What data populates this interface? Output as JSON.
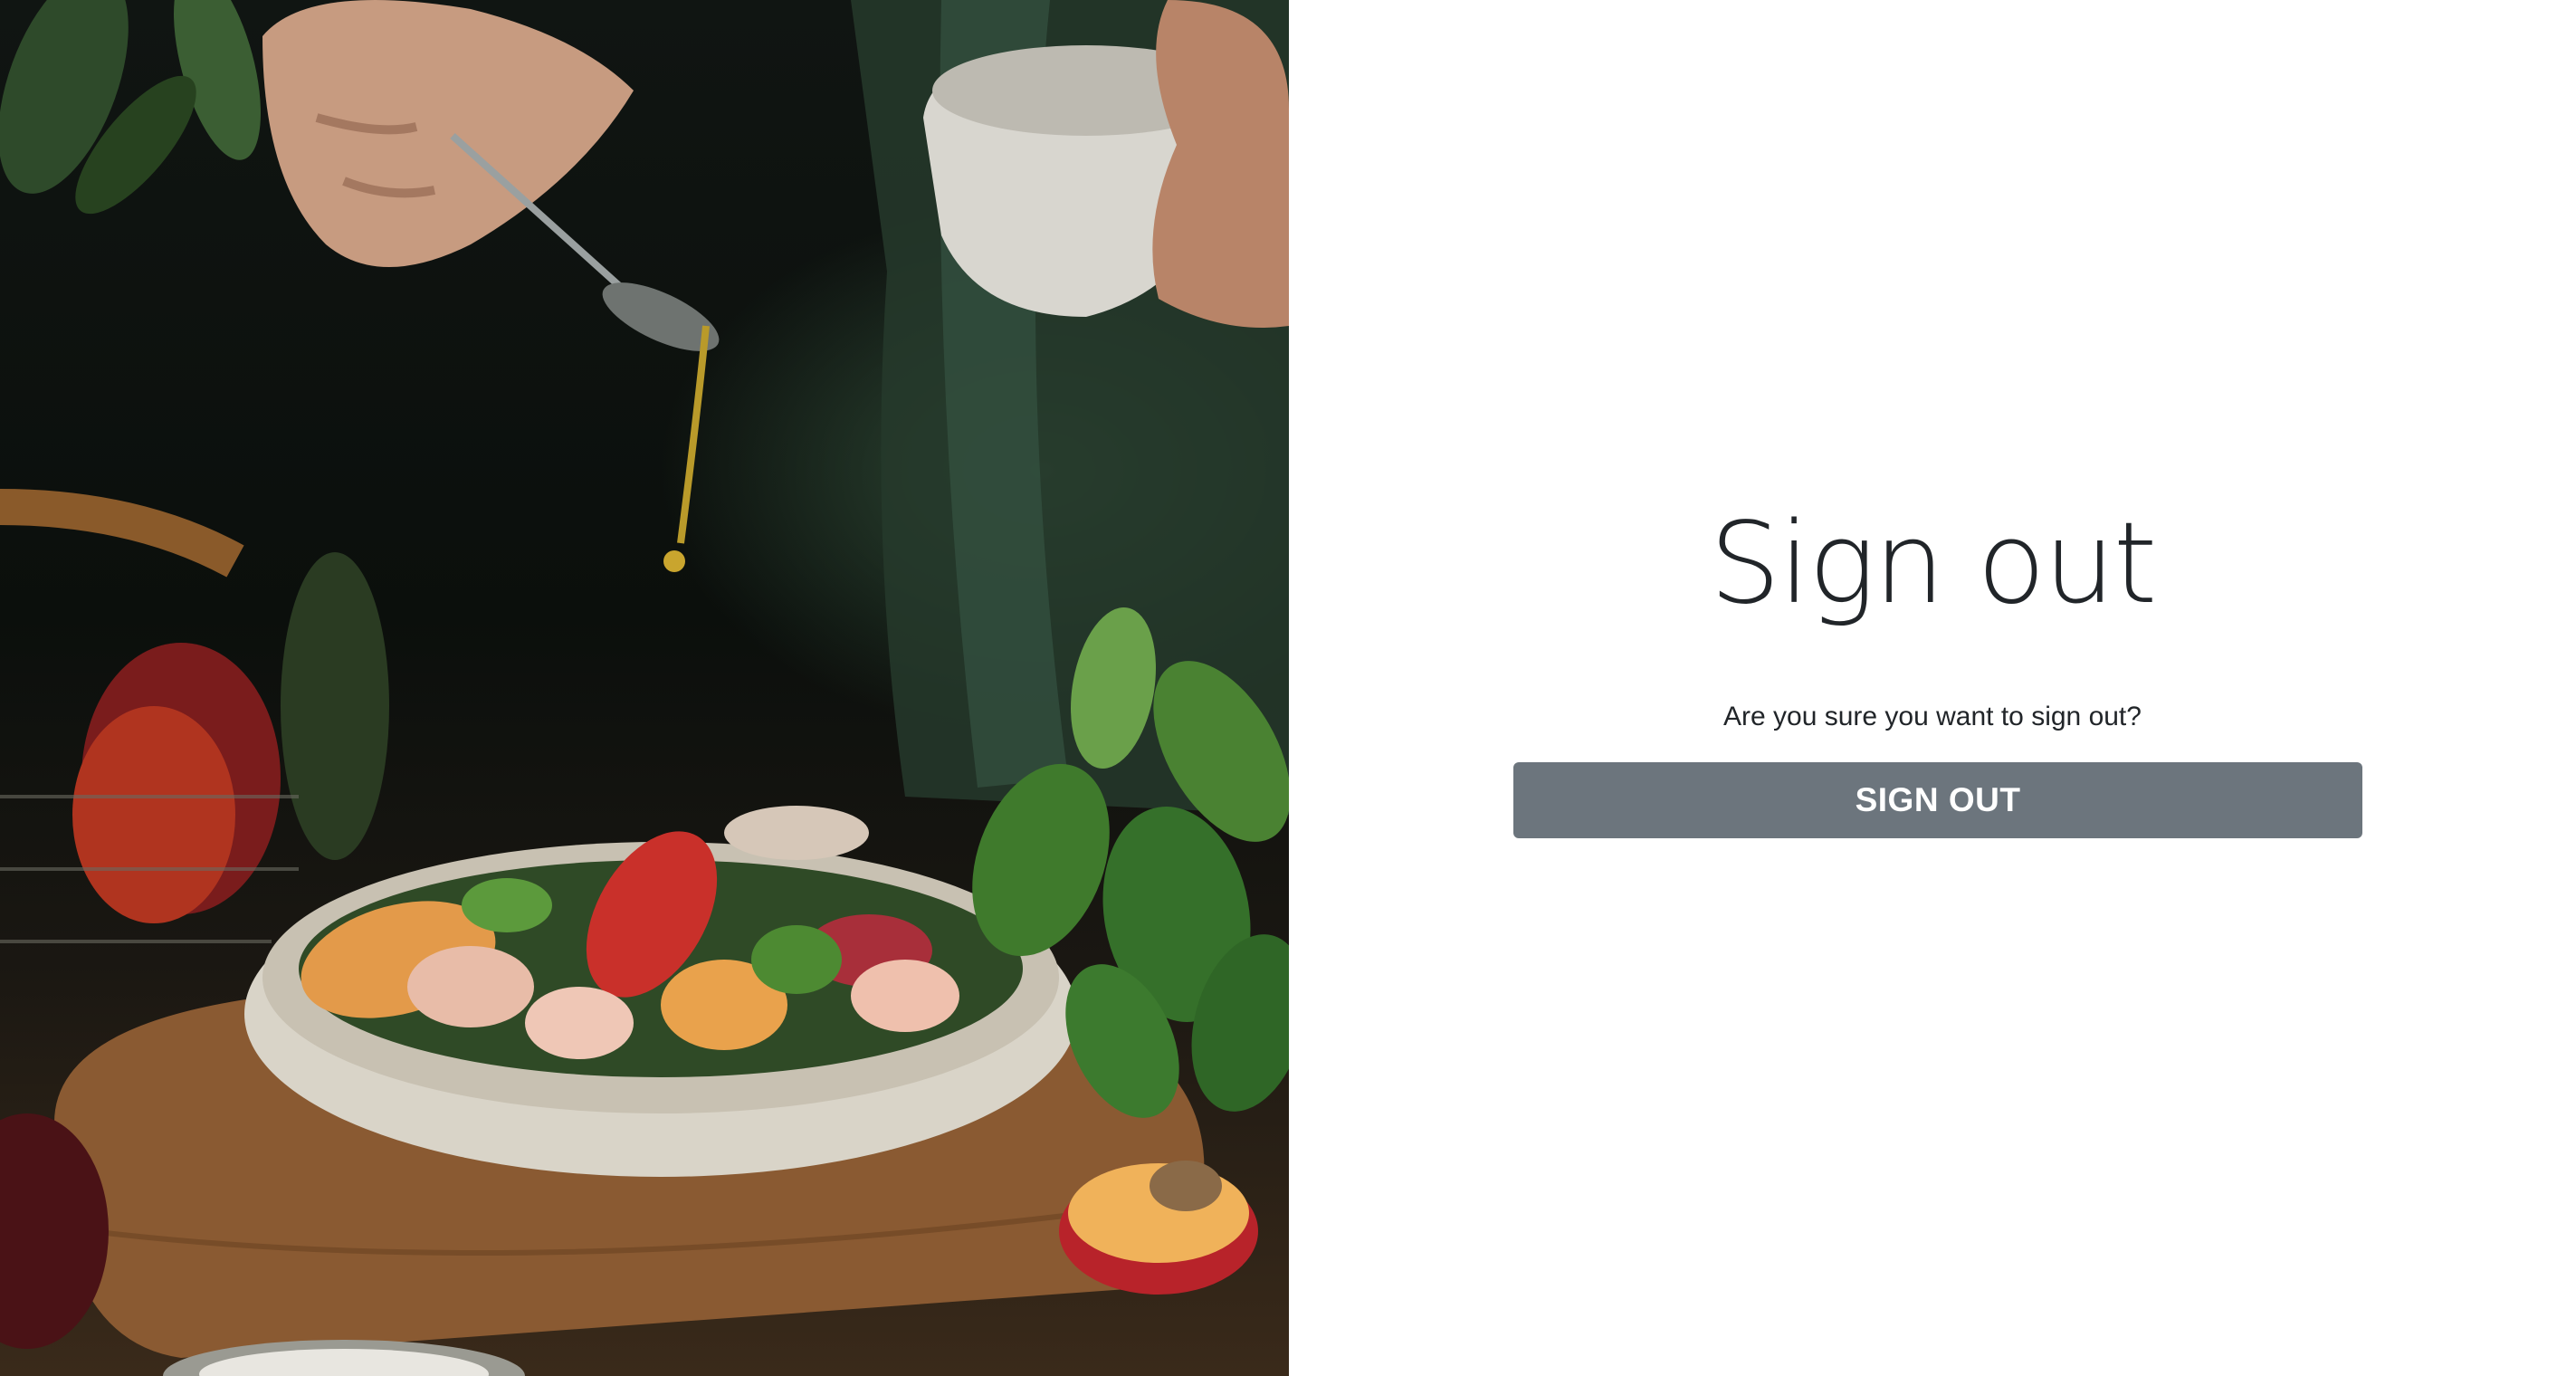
{
  "signout": {
    "title": "Sign out",
    "question": "Are you sure you want to sign out?",
    "button_label": "SIGN OUT"
  },
  "colors": {
    "button_background": "#6c757d",
    "button_text": "#ffffff",
    "text": "#212529",
    "page_background": "#ffffff"
  }
}
